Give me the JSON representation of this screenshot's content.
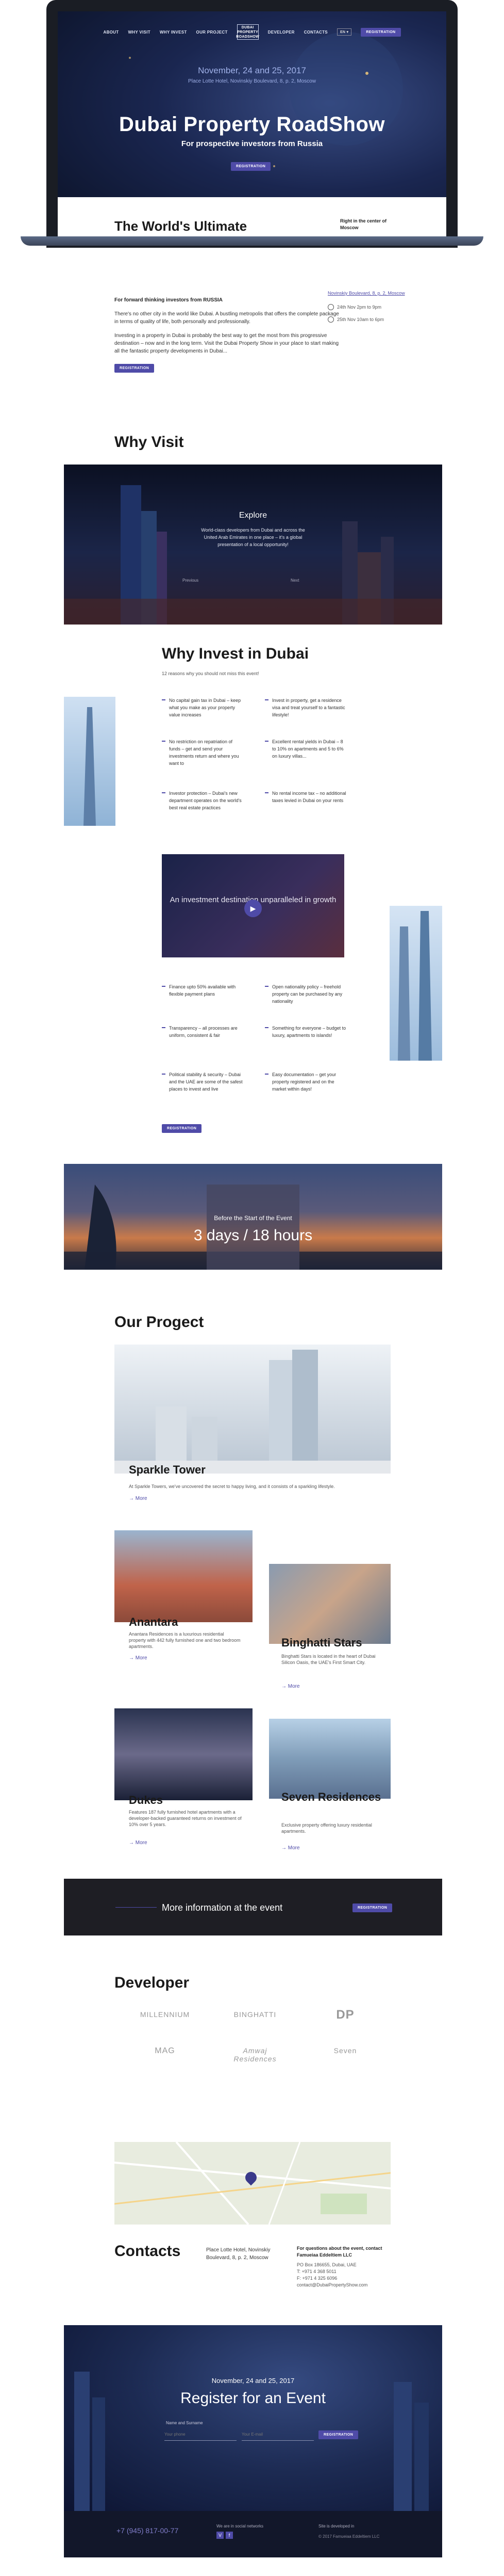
{
  "nav": {
    "items": [
      "ABOUT",
      "WHY VISIT",
      "WHY INVEST",
      "OUR PROJECT",
      "DEVELOPER",
      "CONTACTS"
    ],
    "logo_line1": "DUBAI",
    "logo_line2": "PROPERTY",
    "logo_line3": "ROADSHOW",
    "lang": "EN ▾",
    "register": "REGISTRATION"
  },
  "hero": {
    "date": "November, 24 and 25, 2017",
    "subtitle": "Place Lotte Hotel, Novinskiy Boulevard, 8, p. 2, Moscow",
    "title": "Dubai Property RoadShow",
    "tagline": "For prospective investors from Russia",
    "button": "REGISTRATION"
  },
  "about": {
    "title": "The World's Ultimate Investment Destination",
    "side_label": "Right in the center of Moscow",
    "address": "Novinskiy Boulevard, 8, p. 2, Moscow",
    "time1": "24th Nov 2pm to 9pm",
    "time2": "25th Nov 10am to 6pm",
    "lead": "For forward thinking investors from RUSSIA",
    "para1": "There's no other city in the world like Dubai. A bustling metropolis that offers the complete package in terms of quality of life, both personally and professionally.",
    "para2": "Investing in a property in Dubai is probably the best way to get the most from this progressive destination – now and in the long term. Visit the Dubai Property Show in your place to start making all the fantastic property developments in Dubai...",
    "button": "REGISTRATION"
  },
  "why_visit": {
    "title": "Why Visit",
    "explore": "Explore",
    "text": "World-class developers from Dubai and across the United Arab Emirates in one place – it's a global presentation of a local opportunity!",
    "prev": "Previous",
    "next": "Next"
  },
  "invest": {
    "title": "Why Invest in Dubai",
    "subtitle": "12 reasons why you should not miss this event!",
    "features": [
      "No capital gain tax in Dubai – keep what you make as your property value increases",
      "Invest in property, get a residence visa and treat yourself to a fantastic lifestyle!",
      "No restriction on repatriation of funds – get and send your investments return and where you want to",
      "Excellent rental yields in Dubai – 8 to 10% on apartments and 5 to 6% on luxury villas...",
      "Investor protection – Dubai's new department operates on the world's best real estate practices",
      "No rental income tax – no additional taxes levied in Dubai on your rents",
      "Finance upto 50% available with flexible payment plans",
      "Open nationality policy – freehold property can be purchased by any nationality",
      "Transparency – all processes are uniform, consistent & fair",
      "Something for everyone – budget to luxury, apartments to islands!",
      "Political stability & security – Dubai and the UAE are some of the safest places to invest and live",
      "Easy documentation – get your property registered and on the market within days!"
    ],
    "video_caption": "An investment destination unparalleled in growth",
    "button": "REGISTRATION"
  },
  "countdown": {
    "label": "Before the Start of the Event",
    "value": "3 days / 18 hours"
  },
  "projects": {
    "title": "Our Progect",
    "more": "More",
    "items": [
      {
        "name": "Sparkle Tower",
        "text": "At Sparkle Towers, we've uncovered the secret to happy living, and it consists of a sparkling lifestyle."
      },
      {
        "name": "Anantara",
        "text": "Anantara Residences is a luxurious residential property with 442 fully furnished one and two bedroom apartments."
      },
      {
        "name": "Binghatti Stars",
        "text": "Binghatti Stars is located in the heart of Dubai Silicon Oasis, the UAE's First Smart City."
      },
      {
        "name": "Dukes",
        "text": "Features 187 fully furnished hotel apartments with a developer-backed guaranteed returns on investment of 10% over 5 years."
      },
      {
        "name": "Seven Residences",
        "text": "Exclusive property offering luxury residential apartments."
      }
    ]
  },
  "cta": {
    "text": "More information at the event",
    "button": "REGISTRATION"
  },
  "developer": {
    "title": "Developer",
    "logos": [
      "MILLENNIUM",
      "BINGHATTI",
      "DP",
      "MAG",
      "Amwaj Residences",
      "Seven"
    ]
  },
  "contacts": {
    "title": "Contacts",
    "address": "Place Lotte Hotel, Novinskiy Boulevard, 8, p. 2, Moscow",
    "org_label": "For questions about the event, contact Famueiaa Eddeltiem LLC",
    "lines": [
      "PO Box 186655, Dubai, UAE",
      "T: +971 4 368 5011",
      "F: +971 4 325 6096",
      "contact@DubaiPropertyShow.com"
    ]
  },
  "register": {
    "date": "November, 24 and 25, 2017",
    "title": "Register for an Event",
    "name_placeholder": "Name and Surname",
    "phone_placeholder": "Your phone",
    "email_placeholder": "Your E-mail",
    "button": "REGISTRATION"
  },
  "footer": {
    "phone": "+7 (945) 817-00-77",
    "social_label": "We are in social networks",
    "dev_label": "Site is developed in",
    "copyright": "© 2017 Famueiaa Eddeltiem LLC"
  }
}
